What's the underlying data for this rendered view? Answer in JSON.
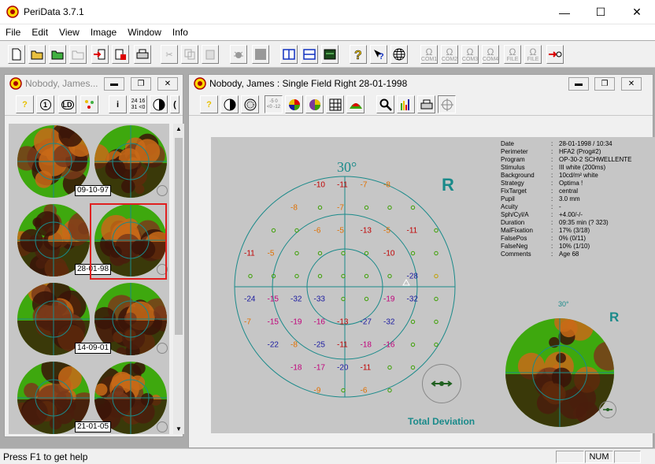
{
  "app": {
    "title": "PeriData 3.7.1"
  },
  "menu": [
    "File",
    "Edit",
    "View",
    "Image",
    "Window",
    "Info"
  ],
  "toolbar": {
    "com": [
      "COM1",
      "COM2",
      "COM3",
      "COM4",
      "FILE",
      "FILE"
    ]
  },
  "left_window": {
    "title": "Nobody, James...",
    "toolbar_labels": {
      "n1": "1",
      "ld": "LD",
      "i": "i",
      "grid_top": "24 16",
      "grid_bot": "31 <0"
    },
    "exams": [
      {
        "date": "09-10-97"
      },
      {
        "date": "28-01-98",
        "selected": true
      },
      {
        "date": "14-09-01"
      },
      {
        "date": "21-01-05"
      }
    ]
  },
  "main_window": {
    "title": "Nobody, James :  Single Field  Right  28-01-1998",
    "toolbar_labels": {
      "scale_top": "-5 0",
      "scale_bot": "<0 -12"
    },
    "plot": {
      "angle_label": "30°",
      "eye": "R",
      "caption": "Total Deviation",
      "values": [
        {
          "r": 0,
          "c": 3,
          "v": "-10",
          "col": "#c00000"
        },
        {
          "r": 0,
          "c": 4,
          "v": "-11",
          "col": "#c00000"
        },
        {
          "r": 0,
          "c": 5,
          "v": "-7",
          "col": "#e07000"
        },
        {
          "r": 0,
          "c": 6,
          "v": "-8",
          "col": "#e07000"
        },
        {
          "r": 1,
          "c": 2,
          "v": "-8",
          "col": "#e07000"
        },
        {
          "r": 1,
          "c": 3,
          "v": "o",
          "col": "#3aa000"
        },
        {
          "r": 1,
          "c": 4,
          "v": "-7",
          "col": "#e07000"
        },
        {
          "r": 1,
          "c": 5,
          "v": "o",
          "col": "#3aa000"
        },
        {
          "r": 1,
          "c": 6,
          "v": "o",
          "col": "#3aa000"
        },
        {
          "r": 1,
          "c": 7,
          "v": "o",
          "col": "#3aa000"
        },
        {
          "r": 2,
          "c": 1,
          "v": "o",
          "col": "#3aa000"
        },
        {
          "r": 2,
          "c": 2,
          "v": "o",
          "col": "#3aa000"
        },
        {
          "r": 2,
          "c": 3,
          "v": "-6",
          "col": "#e07000"
        },
        {
          "r": 2,
          "c": 4,
          "v": "-5",
          "col": "#e07000"
        },
        {
          "r": 2,
          "c": 5,
          "v": "-13",
          "col": "#c00000"
        },
        {
          "r": 2,
          "c": 6,
          "v": "-5",
          "col": "#e07000"
        },
        {
          "r": 2,
          "c": 7,
          "v": "-11",
          "col": "#c00000"
        },
        {
          "r": 2,
          "c": 8,
          "v": "o",
          "col": "#3aa000"
        },
        {
          "r": 3,
          "c": 0,
          "v": "-11",
          "col": "#c00000"
        },
        {
          "r": 3,
          "c": 1,
          "v": "-5",
          "col": "#e07000"
        },
        {
          "r": 3,
          "c": 2,
          "v": "o",
          "col": "#3aa000"
        },
        {
          "r": 3,
          "c": 3,
          "v": "o",
          "col": "#3aa000"
        },
        {
          "r": 3,
          "c": 4,
          "v": "o",
          "col": "#3aa000"
        },
        {
          "r": 3,
          "c": 5,
          "v": "o",
          "col": "#3aa000"
        },
        {
          "r": 3,
          "c": 6,
          "v": "-10",
          "col": "#c00000"
        },
        {
          "r": 3,
          "c": 7,
          "v": "o",
          "col": "#3aa000"
        },
        {
          "r": 3,
          "c": 8,
          "v": "o",
          "col": "#3aa000"
        },
        {
          "r": 4,
          "c": 0,
          "v": "o",
          "col": "#3aa000"
        },
        {
          "r": 4,
          "c": 1,
          "v": "o",
          "col": "#3aa000"
        },
        {
          "r": 4,
          "c": 2,
          "v": "o",
          "col": "#3aa000"
        },
        {
          "r": 4,
          "c": 3,
          "v": "o",
          "col": "#3aa000"
        },
        {
          "r": 4,
          "c": 4,
          "v": "o",
          "col": "#3aa000"
        },
        {
          "r": 4,
          "c": 5,
          "v": "o",
          "col": "#3aa000"
        },
        {
          "r": 4,
          "c": 6,
          "v": "o",
          "col": "#3aa000"
        },
        {
          "r": 4,
          "c": 7,
          "v": "-28",
          "col": "#1a1aa0"
        },
        {
          "r": 4,
          "c": 8,
          "v": "o",
          "col": "#c0a000"
        },
        {
          "r": 5,
          "c": 0,
          "v": "-24",
          "col": "#1a1aa0"
        },
        {
          "r": 5,
          "c": 1,
          "v": "-15",
          "col": "#c0007a"
        },
        {
          "r": 5,
          "c": 2,
          "v": "-32",
          "col": "#1a1aa0"
        },
        {
          "r": 5,
          "c": 3,
          "v": "-33",
          "col": "#1a1aa0"
        },
        {
          "r": 5,
          "c": 4,
          "v": "o",
          "col": "#3aa000"
        },
        {
          "r": 5,
          "c": 5,
          "v": "o",
          "col": "#3aa000"
        },
        {
          "r": 5,
          "c": 6,
          "v": "-19",
          "col": "#c0007a"
        },
        {
          "r": 5,
          "c": 7,
          "v": "-32",
          "col": "#1a1aa0"
        },
        {
          "r": 5,
          "c": 8,
          "v": "o",
          "col": "#3aa000"
        },
        {
          "r": 6,
          "c": 0,
          "v": "-7",
          "col": "#e07000"
        },
        {
          "r": 6,
          "c": 1,
          "v": "-15",
          "col": "#c0007a"
        },
        {
          "r": 6,
          "c": 2,
          "v": "-19",
          "col": "#c0007a"
        },
        {
          "r": 6,
          "c": 3,
          "v": "-16",
          "col": "#c0007a"
        },
        {
          "r": 6,
          "c": 4,
          "v": "-13",
          "col": "#c00000"
        },
        {
          "r": 6,
          "c": 5,
          "v": "-27",
          "col": "#1a1aa0"
        },
        {
          "r": 6,
          "c": 6,
          "v": "-32",
          "col": "#1a1aa0"
        },
        {
          "r": 6,
          "c": 7,
          "v": "o",
          "col": "#3aa000"
        },
        {
          "r": 6,
          "c": 8,
          "v": "o",
          "col": "#3aa000"
        },
        {
          "r": 7,
          "c": 1,
          "v": "-22",
          "col": "#1a1aa0"
        },
        {
          "r": 7,
          "c": 2,
          "v": "-8",
          "col": "#e07000"
        },
        {
          "r": 7,
          "c": 3,
          "v": "-25",
          "col": "#1a1aa0"
        },
        {
          "r": 7,
          "c": 4,
          "v": "-11",
          "col": "#c00000"
        },
        {
          "r": 7,
          "c": 5,
          "v": "-18",
          "col": "#c0007a"
        },
        {
          "r": 7,
          "c": 6,
          "v": "-16",
          "col": "#c0007a"
        },
        {
          "r": 7,
          "c": 7,
          "v": "o",
          "col": "#3aa000"
        },
        {
          "r": 7,
          "c": 8,
          "v": "o",
          "col": "#3aa000"
        },
        {
          "r": 8,
          "c": 2,
          "v": "-18",
          "col": "#c0007a"
        },
        {
          "r": 8,
          "c": 3,
          "v": "-17",
          "col": "#c0007a"
        },
        {
          "r": 8,
          "c": 4,
          "v": "-20",
          "col": "#1a1aa0"
        },
        {
          "r": 8,
          "c": 5,
          "v": "-11",
          "col": "#c00000"
        },
        {
          "r": 8,
          "c": 6,
          "v": "o",
          "col": "#3aa000"
        },
        {
          "r": 8,
          "c": 7,
          "v": "o",
          "col": "#3aa000"
        },
        {
          "r": 9,
          "c": 3,
          "v": "-9",
          "col": "#e07000"
        },
        {
          "r": 9,
          "c": 4,
          "v": "o",
          "col": "#3aa000"
        },
        {
          "r": 9,
          "c": 5,
          "v": "-6",
          "col": "#e07000"
        },
        {
          "r": 9,
          "c": 6,
          "v": "o",
          "col": "#3aa000"
        }
      ]
    },
    "info": [
      [
        "Date",
        "28-01-1998 / 10:34"
      ],
      [
        "Perimeter",
        "HFA2 (Prog#2)"
      ],
      [
        "Program",
        "OP-30-2 SCHWELLENTE"
      ],
      [
        "Stimulus",
        "III white (200ms)"
      ],
      [
        "Background",
        "10cd/m² white"
      ],
      [
        "Strategy",
        "Optima !"
      ],
      [
        "FixTarget",
        "central"
      ],
      [
        "Pupil",
        "3.0 mm"
      ],
      [
        "Acuity",
        "-"
      ],
      [
        "Sph/Cyl/A",
        "+4.00/-/-"
      ],
      [
        "Duration",
        "09:35 min (? 323)"
      ],
      [
        "MalFixation",
        "17% (3/18)"
      ],
      [
        "FalsePos",
        "0% (0/11)"
      ],
      [
        "FalseNeg",
        "10% (1/10)"
      ],
      [
        "Comments",
        "Age 68"
      ]
    ],
    "minimap": {
      "angle_label": "30°",
      "eye": "R"
    }
  },
  "status": {
    "message": "Press F1 to get help",
    "num": "NUM"
  },
  "colors": {
    "field_green": "#3ea80e",
    "field_brown": "#7a3a1a",
    "field_dark": "#3a1408",
    "field_orange": "#c86a18",
    "teal": "#1a8a8a"
  }
}
